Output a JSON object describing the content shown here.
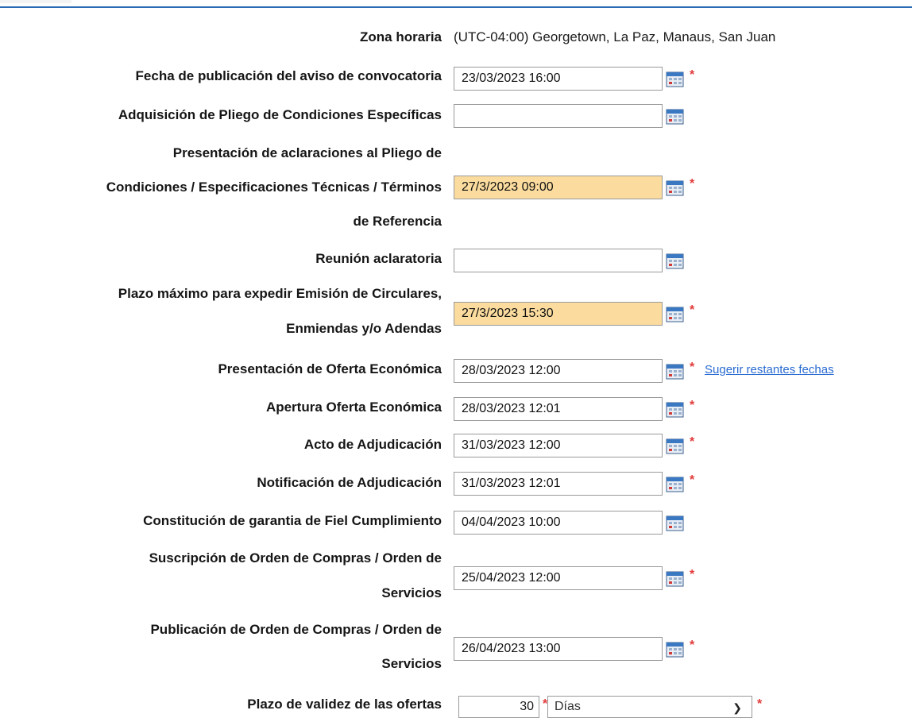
{
  "timezone": {
    "label": "Zona horaria",
    "value": "(UTC-04:00) Georgetown, La Paz, Manaus, San Juan"
  },
  "rows": [
    {
      "lines": [
        "Fecha de publicación del aviso de convocatoria"
      ],
      "value": "23/03/2023 16:00",
      "highlight": false,
      "required": true
    },
    {
      "lines": [
        "Adquisición de Pliego de Condiciones Específicas"
      ],
      "value": "",
      "highlight": false,
      "required": false
    },
    {
      "lines": [
        "Presentación de aclaraciones al Pliego de",
        "Condiciones / Especificaciones Técnicas / Términos",
        "de Referencia"
      ],
      "value": "27/3/2023 09:00",
      "highlight": true,
      "required": true
    },
    {
      "lines": [
        "Reunión aclaratoria"
      ],
      "value": "",
      "highlight": false,
      "required": false
    },
    {
      "lines": [
        "Plazo máximo para expedir Emisión de Circulares,",
        "Enmiendas y/o Adendas"
      ],
      "value": "27/3/2023 15:30",
      "highlight": true,
      "required": true
    },
    {
      "lines": [
        "Presentación de Oferta Económica"
      ],
      "value": "28/03/2023 12:00",
      "highlight": false,
      "required": true,
      "link": "Sugerir restantes fechas"
    },
    {
      "lines": [
        "Apertura Oferta Económica"
      ],
      "value": "28/03/2023 12:01",
      "highlight": false,
      "required": true
    },
    {
      "lines": [
        "Acto de Adjudicación"
      ],
      "value": "31/03/2023 12:00",
      "highlight": false,
      "required": true
    },
    {
      "lines": [
        "Notificación de Adjudicación"
      ],
      "value": "31/03/2023 12:01",
      "highlight": false,
      "required": true
    },
    {
      "lines": [
        "Constitución de garantia de Fiel Cumplimiento"
      ],
      "value": "04/04/2023 10:00",
      "highlight": false,
      "required": false
    },
    {
      "lines": [
        "Suscripción de Orden de Compras / Orden de",
        "Servicios"
      ],
      "value": "25/04/2023 12:00",
      "highlight": false,
      "required": true
    },
    {
      "lines": [
        "Publicación de Orden de Compras / Orden de",
        "Servicios"
      ],
      "value": "26/04/2023 13:00",
      "highlight": false,
      "required": true
    }
  ],
  "validity": {
    "label": "Plazo de validez de las ofertas",
    "number": "30",
    "unit": "Días",
    "required_mark": "*"
  },
  "required_mark": "*",
  "icons": {
    "calendar": "calendar-icon",
    "chevron": "chevron-down-icon"
  },
  "colors": {
    "highlight": "#fbdc9e",
    "required": "#e23b3b",
    "link": "#2a6bd1",
    "accent_line": "#2a6bb5"
  }
}
